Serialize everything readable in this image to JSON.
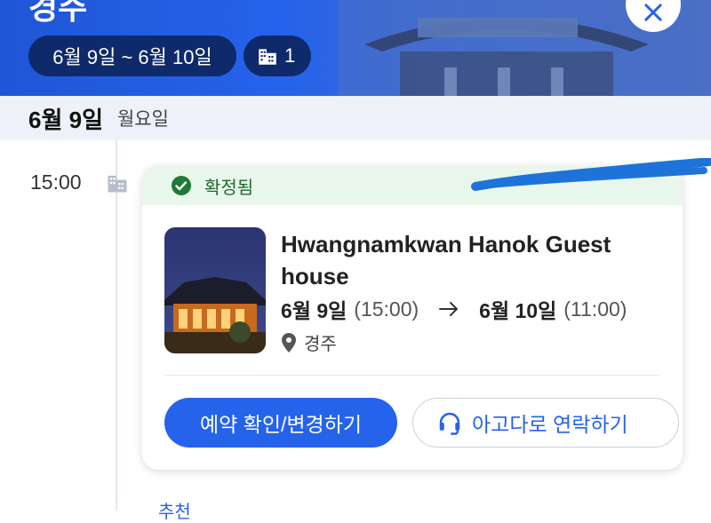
{
  "header": {
    "city_title": "경주",
    "dates_chip": "6월 9일 ~ 6월 10일",
    "rooms_count": "1",
    "icons": {
      "building": "building-icon",
      "close": "close-icon"
    }
  },
  "day": {
    "date": "6월 9일",
    "weekday": "월요일"
  },
  "timeline": {
    "time": "15:00"
  },
  "card": {
    "status": "확정됨",
    "hotel_name": "Hwangnamkwan Hanok Guest house",
    "checkin_date": "6월 9일",
    "checkin_time": "(15:00)",
    "checkout_date": "6월 10일",
    "checkout_time": "(11:00)",
    "location": "경주",
    "primary_button": "예약 확인/변경하기",
    "secondary_button": "아고다로 연락하기"
  },
  "bottom_peek": "추천",
  "colors": {
    "primary": "#2563eb",
    "header": "#1f56d6",
    "status_bg": "#e9f6ec",
    "status_fg": "#1c6b2e"
  }
}
